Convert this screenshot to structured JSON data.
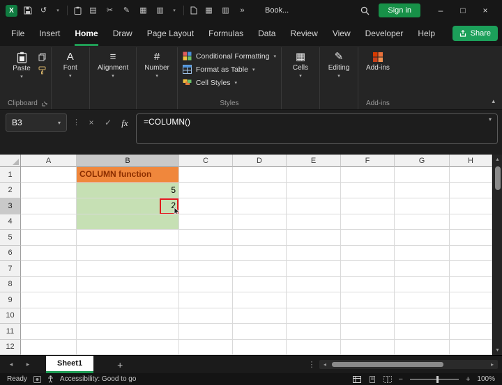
{
  "titlebar": {
    "title": "Book...",
    "sign_in_label": "Sign in"
  },
  "menu": {
    "items": [
      "File",
      "Insert",
      "Home",
      "Draw",
      "Page Layout",
      "Formulas",
      "Data",
      "Review",
      "View",
      "Developer",
      "Help"
    ],
    "active_item": "Home",
    "share_label": "Share"
  },
  "ribbon": {
    "paste_label": "Paste",
    "font_label": "Font",
    "alignment_label": "Alignment",
    "number_label": "Number",
    "cells_label": "Cells",
    "editing_label": "Editing",
    "addins_label": "Add-ins",
    "styles": {
      "conditional_formatting": "Conditional Formatting",
      "format_as_table": "Format as Table",
      "cell_styles": "Cell Styles"
    },
    "group_labels": {
      "clipboard": "Clipboard",
      "styles": "Styles",
      "addins": "Add-ins"
    }
  },
  "formula_bar": {
    "name_box": "B3",
    "formula": "=COLUMN()",
    "fx_label": "fx"
  },
  "grid": {
    "columns": [
      "A",
      "B",
      "C",
      "D",
      "E",
      "F",
      "G",
      "H"
    ],
    "rows": [
      "1",
      "2",
      "3",
      "4",
      "5",
      "6",
      "7",
      "8",
      "9",
      "10",
      "11",
      "12"
    ],
    "cells": {
      "B1": "COLUMN function",
      "B2": "5",
      "B3": "2"
    },
    "selected_cell": "B3",
    "selected_column": "B",
    "selected_row": "3"
  },
  "sheet_bar": {
    "active_tab": "Sheet1"
  },
  "status_bar": {
    "mode": "Ready",
    "accessibility": "Accessibility: Good to go",
    "zoom_level": "100%"
  },
  "icons": {
    "chevron_down": "▾",
    "chevron_up": "▴",
    "undo": "↺",
    "cut": "✂",
    "pen": "✎",
    "book": "▤",
    "table": "▦",
    "grid": "▥",
    "overflow": "»",
    "minimize": "–",
    "maximize": "□",
    "close": "×",
    "cancel": "×",
    "confirm": "✓",
    "dots_vertical": "⋮",
    "left": "◂",
    "right": "▸",
    "up": "▴",
    "down": "▾",
    "plus": "+",
    "minus": "−",
    "font_glyph": "A",
    "alignment_glyph": "≡",
    "number_glyph": "#",
    "editing_glyph": "✎",
    "cells_glyph": "▦"
  },
  "colors": {
    "accent_green": "#1F9D55",
    "signin_green": "#179148",
    "cell_fill_orange": "#F0873C",
    "cell_text_red": "#8C2E00",
    "cell_fill_green": "#C6E0B4",
    "annotation_red": "#E01B1B",
    "addins_orange": "#D83B01"
  }
}
